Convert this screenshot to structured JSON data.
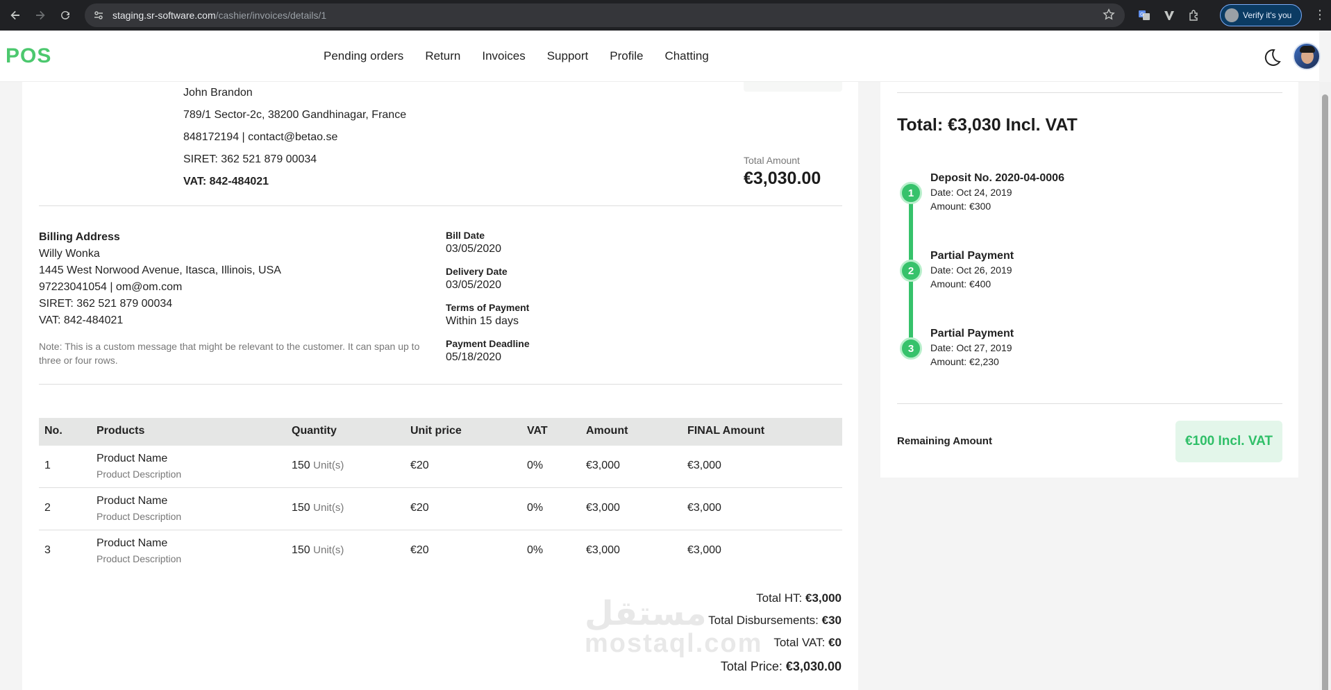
{
  "browser": {
    "url_host": "staging.sr-software.com",
    "url_path": "/cashier/invoices/details/1",
    "verify_label": "Verify it's you"
  },
  "header": {
    "logo": "POS",
    "menu": [
      "Pending orders",
      "Return",
      "Invoices",
      "Support",
      "Profile",
      "Chatting"
    ]
  },
  "seller": {
    "name": "John Brandon",
    "address": "789/1 Sector-2c, 38200 Gandhinagar, France",
    "contact": "848172194 | contact@betao.se",
    "siret": "SIRET: 362 521 879 00034",
    "vat": "VAT: 842-484021"
  },
  "total_amount": {
    "label": "Total Amount",
    "value": "€3,030.00"
  },
  "billing": {
    "title": "Billing Address",
    "name": "Willy Wonka",
    "address": "1445 West Norwood Avenue, Itasca, Illinois, USA",
    "contact": "97223041054 | om@om.com",
    "siret": "SIRET: 362 521 879 00034",
    "vat": "VAT: 842-484021",
    "note": "Note: This is a custom message that might be relevant to the customer. It can span up to three or four rows."
  },
  "dates": {
    "bill_date_label": "Bill Date",
    "bill_date": "03/05/2020",
    "delivery_label": "Delivery Date",
    "delivery": "03/05/2020",
    "terms_label": "Terms of Payment",
    "terms": "Within 15 days",
    "deadline_label": "Payment Deadline",
    "deadline": "05/18/2020"
  },
  "table": {
    "headers": [
      "No.",
      "Products",
      "Quantity",
      "Unit price",
      "VAT",
      "Amount",
      "FINAL Amount"
    ],
    "rows": [
      {
        "no": "1",
        "name": "Product Name",
        "desc": "Product Description",
        "qty": "150",
        "unit": "Unit(s)",
        "price": "€20",
        "vat": "0%",
        "amount": "€3,000",
        "final": "€3,000"
      },
      {
        "no": "2",
        "name": "Product Name",
        "desc": "Product Description",
        "qty": "150",
        "unit": "Unit(s)",
        "price": "€20",
        "vat": "0%",
        "amount": "€3,000",
        "final": "€3,000"
      },
      {
        "no": "3",
        "name": "Product Name",
        "desc": "Product Description",
        "qty": "150",
        "unit": "Unit(s)",
        "price": "€20",
        "vat": "0%",
        "amount": "€3,000",
        "final": "€3,000"
      }
    ]
  },
  "totals": {
    "ht_label": "Total HT:",
    "ht": "€3,000",
    "disb_label": "Total Disbursements:",
    "disb": "€30",
    "vat_label": "Total VAT:",
    "vat": "€0",
    "price_label": "Total Price:",
    "price": "€3,030.00"
  },
  "watermark": {
    "ar": "مستقل",
    "en": "mostaql.com"
  },
  "side": {
    "total": "Total: €3,030 Incl. VAT",
    "steps": [
      {
        "n": "1",
        "title": "Deposit No. 2020-04-0006",
        "date": "Date: Oct 24, 2019",
        "amount": "Amount: €300"
      },
      {
        "n": "2",
        "title": "Partial Payment",
        "date": "Date: Oct 26, 2019",
        "amount": "Amount: €400"
      },
      {
        "n": "3",
        "title": "Partial Payment",
        "date": "Date: Oct 27, 2019",
        "amount": "Amount: €2,230"
      }
    ],
    "remaining_label": "Remaining Amount",
    "remaining_value": "€100 Incl. VAT"
  },
  "colors": {
    "accent_green": "#36c26b",
    "logo_green": "#4cc86e",
    "chrome_dark": "#202124"
  }
}
